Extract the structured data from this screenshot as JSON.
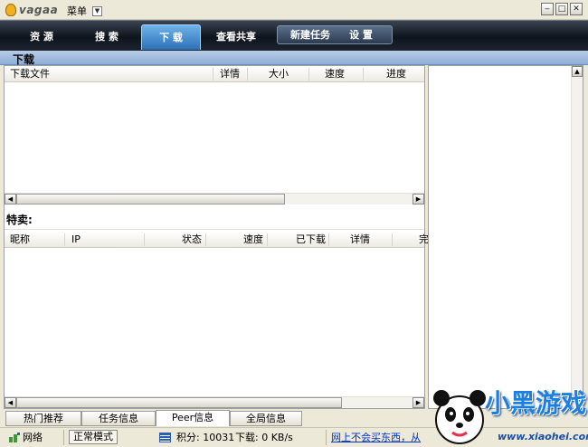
{
  "app": {
    "logo_text": "vagaa",
    "menu_label": "菜单"
  },
  "nav": {
    "tabs": [
      {
        "label": "资 源"
      },
      {
        "label": "搜 索"
      },
      {
        "label": "下 载"
      },
      {
        "label": "查看共享"
      }
    ],
    "active": "下 载",
    "group": [
      {
        "label": "新建任务"
      },
      {
        "label": "设 置"
      }
    ]
  },
  "section": {
    "title": "下载"
  },
  "downloads": {
    "columns": [
      "下载文件",
      "详情",
      "大小",
      "速度",
      "进度"
    ]
  },
  "special": {
    "label": "特卖:"
  },
  "peers": {
    "columns": [
      "昵称",
      "IP",
      "状态",
      "速度",
      "已下载",
      "详情",
      "完"
    ]
  },
  "bottom_tabs": [
    {
      "label": "热门推荐"
    },
    {
      "label": "任务信息"
    },
    {
      "label": "Peer信息"
    },
    {
      "label": "全局信息"
    }
  ],
  "bottom_tabs_active": "Peer信息",
  "status": {
    "network_label": "网络",
    "mode_label": "正常模式",
    "score_text": "积分: 10031",
    "download_text": "下载: 0 KB/s",
    "link_text": "网上不会买东西，从"
  },
  "watermark": {
    "brand": "小黑游戏",
    "url": "www.xiaohei.com"
  },
  "colors": {
    "nav_active": "#2d6fb8",
    "section_head": "#8faed6",
    "link": "#0033cc"
  }
}
